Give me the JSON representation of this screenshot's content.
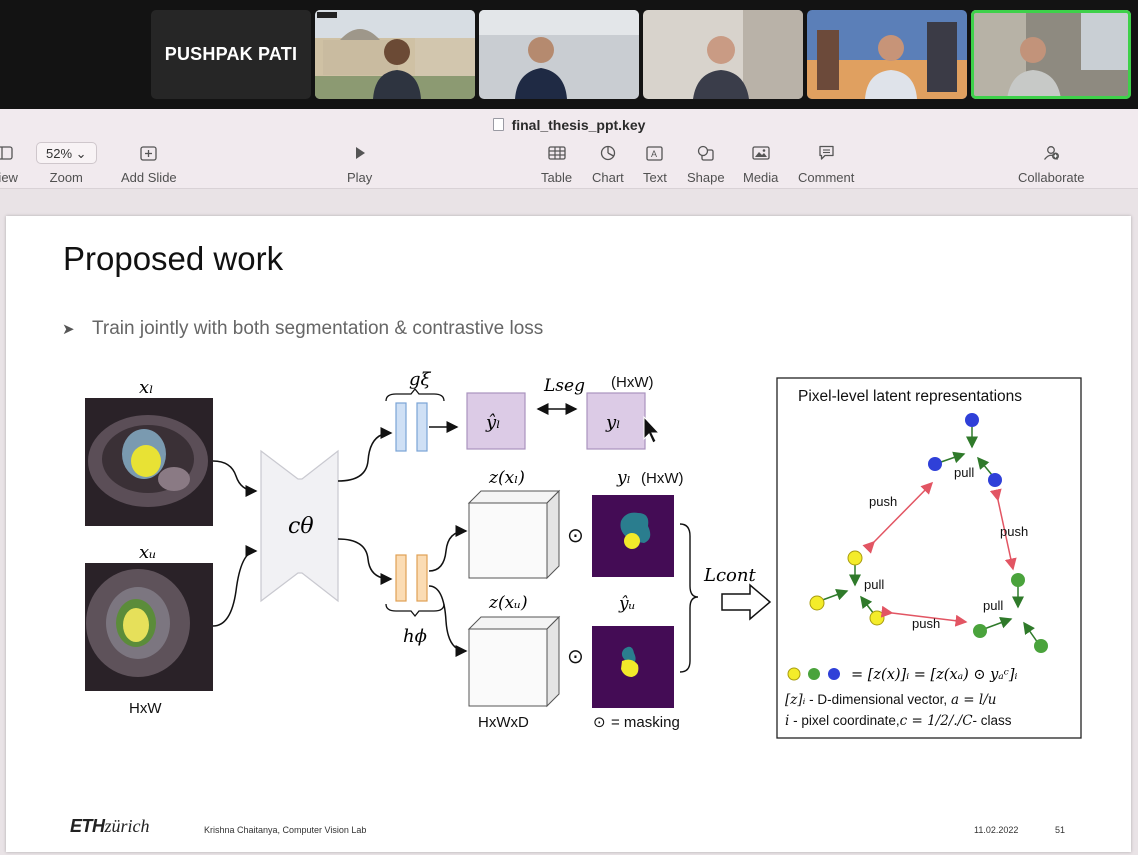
{
  "meeting": {
    "name_tile": "PUSHPAK PATI",
    "active_speaker_color": "#3ed14a"
  },
  "toolbar": {
    "document_title": "final_thesis_ppt.key",
    "view_label": "View",
    "zoom_value": "52%",
    "zoom_label": "Zoom",
    "add_slide_label": "Add Slide",
    "play_label": "Play",
    "table_label": "Table",
    "chart_label": "Chart",
    "text_label": "Text",
    "shape_label": "Shape",
    "media_label": "Media",
    "comment_label": "Comment",
    "collaborate_label": "Collaborate"
  },
  "slide": {
    "title": "Proposed work",
    "bullet": "Train jointly with both segmentation & contrastive loss",
    "diagram": {
      "x_l": "xₗ",
      "x_u": "xᵤ",
      "input_size": "HxW",
      "encoder": "cθ",
      "g_head": "gξ",
      "h_head": "hϕ",
      "y_hat_l": "ŷₗ",
      "y_l": "yₗ",
      "l_seg": "Lseg",
      "hxw_top": "(HxW)",
      "z_xl": "z(xₗ)",
      "z_xu": "z(xᵤ)",
      "y_l_mask_label": "yₗ",
      "hxw_mask": "(HxW)",
      "y_hat_u": "ŷᵤ",
      "feature_size": "HxWxD",
      "masking_legend": "= masking",
      "odot": "⊙",
      "l_cont": "Lcont",
      "panel_title": "Pixel-level latent representations",
      "pull": "pull",
      "push": "push",
      "eq_line": "= [z(x)]ᵢ = [z(xₐ) ⊙ yₐᶜ]ᵢ",
      "def_line1_a": "[z]ᵢ",
      "def_line1_b": " - D-dimensional vector,  ",
      "def_line1_c": "a = l/u",
      "def_line2_a": "i",
      "def_line2_b": " - pixel coordinate,",
      "def_line2_c": "c = 1/2/./C",
      "def_line2_d": "- class",
      "colors": {
        "yellow": "#f4ec2a",
        "green": "#4aa33c",
        "blue": "#2f40d8",
        "purple_box": "#dccbe6",
        "head_blue": "#cfe0f5",
        "head_orange": "#fbdcb4"
      }
    }
  },
  "footer": {
    "logo_bold": "ETH",
    "logo_rest": "zürich",
    "author": "Krishna Chaitanya, Computer Vision Lab",
    "date": "11.02.2022",
    "page": "51"
  }
}
